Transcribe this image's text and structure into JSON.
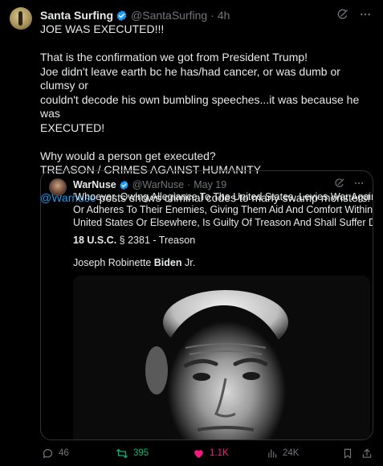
{
  "post": {
    "author": {
      "display_name": "Santa Surfing",
      "handle": "@SantaSurfing",
      "time": "4h"
    },
    "paragraphs": [
      [
        "JOE WAS EXECUTED!!!"
      ],
      [
        "That is the confirmation we got from President Trump!",
        "Joe didn't leave earth bc he has/had  cancer, or was dumb or clumsy or",
        "couldn't decode his own bumbling speeches...it was because he was",
        "EXECUTED!"
      ],
      [
        "Why would a person get executed?",
        "TREASON / CRIMES AGAINST HUMANITY"
      ]
    ],
    "mention": "@Warnuse",
    "mention_rest": " posts shows criminal codes to many swamp monsters!",
    "quote": {
      "display_name": "WarNuse",
      "handle": "@WarNuse",
      "date": "May 19",
      "text_lines": [
        "'Whoever, Owing Allegiance To The United States, Levies War Against Them",
        "Or Adheres To Their Enemies, Giving Them Aid And Comfort Within The",
        "United States Or Elsewhere, Is Guilty Of Treason And Shall Suffer Death.'"
      ],
      "usc_bold": "18 U.S.C.",
      "usc_rest": " § 2381 - Treason",
      "name_pre": "Joseph Robinette ",
      "name_bold": "Biden",
      "name_post": " Jr."
    },
    "actions": {
      "replies": "46",
      "reposts": "395",
      "likes": "1.1K",
      "views": "24K"
    }
  },
  "colors": {
    "background": "#000000",
    "text": "#e7e9ea",
    "muted": "#71767b",
    "accent": "#1d9bf0",
    "repost": "#00ba7c",
    "like": "#f91880",
    "border": "#2f3336"
  },
  "icons": [
    "verified-badge-icon",
    "grok-icon",
    "more-icon",
    "reply-icon",
    "repost-icon",
    "like-icon",
    "views-icon",
    "bookmark-icon",
    "share-icon"
  ]
}
